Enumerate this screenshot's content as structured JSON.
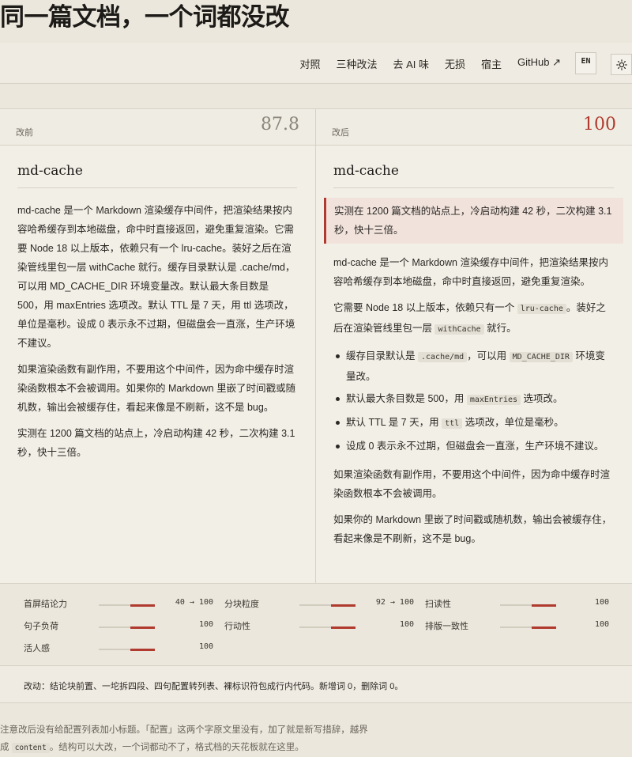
{
  "page": {
    "title": "同一篇文档，一个词都没改"
  },
  "nav": {
    "links": [
      "对照",
      "三种改法",
      "去 AI 味",
      "无损",
      "宿主",
      "GitHub ↗"
    ],
    "lang_button": "EN",
    "theme_icon": "sun-icon"
  },
  "before": {
    "label": "改前",
    "score": "87.8",
    "doc_title": "md-cache",
    "paragraphs": [
      "md-cache 是一个 Markdown 渲染缓存中间件，把渲染结果按内容哈希缓存到本地磁盘，命中时直接返回，避免重复渲染。它需要 Node 18 以上版本，依赖只有一个 lru-cache。装好之后在渲染管线里包一层 withCache 就行。缓存目录默认是 .cache/md，可以用 MD_CACHE_DIR 环境变量改。默认最大条目数是 500，用 maxEntries 选项改。默认 TTL 是 7 天，用 ttl 选项改，单位是毫秒。设成 0 表示永不过期，但磁盘会一直涨，生产环境不建议。",
      "如果渲染函数有副作用，不要用这个中间件，因为命中缓存时渲染函数根本不会被调用。如果你的 Markdown 里嵌了时间戳或随机数，输出会被缓存住，看起来像是不刷新，这不是 bug。",
      "实测在 1200 篇文档的站点上，冷启动构建 42 秒，二次构建 3.1 秒，快十三倍。"
    ]
  },
  "after": {
    "label": "改后",
    "score": "100",
    "doc_title": "md-cache",
    "callout": "实测在 1200 篇文档的站点上，冷启动构建 42 秒，二次构建 3.1 秒，快十三倍。",
    "p1": "md-cache 是一个 Markdown 渲染缓存中间件，把渲染结果按内容哈希缓存到本地磁盘，命中时直接返回，避免重复渲染。",
    "p2": {
      "a": "它需要 Node 18 以上版本，依赖只有一个 ",
      "code1": "lru-cache",
      "b": "。装好之后在渲染管线里包一层 ",
      "code2": "withCache",
      "c": " 就行。"
    },
    "bullets": {
      "b1": {
        "a": "缓存目录默认是 ",
        "code1": ".cache/md",
        "b": "，可以用 ",
        "code2": "MD_CACHE_DIR",
        "c": " 环境变量改。"
      },
      "b2": {
        "a": "默认最大条目数是 500，用 ",
        "code1": "maxEntries",
        "b": " 选项改。"
      },
      "b3": {
        "a": "默认 TTL 是 7 天，用 ",
        "code1": "ttl",
        "b": " 选项改，单位是毫秒。"
      },
      "b4": "设成 0 表示永不过期，但磁盘会一直涨，生产环境不建议。"
    },
    "p3": "如果渲染函数有副作用，不要用这个中间件，因为命中缓存时渲染函数根本不会被调用。",
    "p4": "如果你的 Markdown 里嵌了时间戳或随机数，输出会被缓存住，看起来像是不刷新，这不是 bug。"
  },
  "metrics": [
    {
      "name": "首屏结论力",
      "value": "40 → 100",
      "before_pct": 40,
      "after_pct": 100
    },
    {
      "name": "分块粒度",
      "value": "92 → 100",
      "before_pct": 92,
      "after_pct": 100
    },
    {
      "name": "扫读性",
      "value": "100",
      "before_pct": 100,
      "after_pct": 100
    },
    {
      "name": "句子负荷",
      "value": "100",
      "before_pct": 100,
      "after_pct": 100
    },
    {
      "name": "行动性",
      "value": "100",
      "before_pct": 100,
      "after_pct": 100
    },
    {
      "name": "排版一致性",
      "value": "100",
      "before_pct": 100,
      "after_pct": 100
    },
    {
      "name": "活人感",
      "value": "100",
      "before_pct": 100,
      "after_pct": 100
    }
  ],
  "summary": "改动：结论块前置、一坨拆四段、四句配置转列表、裸标识符包成行内代码。新增词 0，删除词 0。",
  "note": {
    "a": "注意改后没有给配置列表加小标题。「配置」这两个字原文里没有，加了就是新写措辞，越界成 ",
    "code": "content",
    "b": "。结构可以大改，一个词都动不了，格式档的天花板就在这里。"
  },
  "colors": {
    "accent": "#b03a2e",
    "background": "#ebe7dd",
    "callout_bg": "#f1e2dc"
  }
}
